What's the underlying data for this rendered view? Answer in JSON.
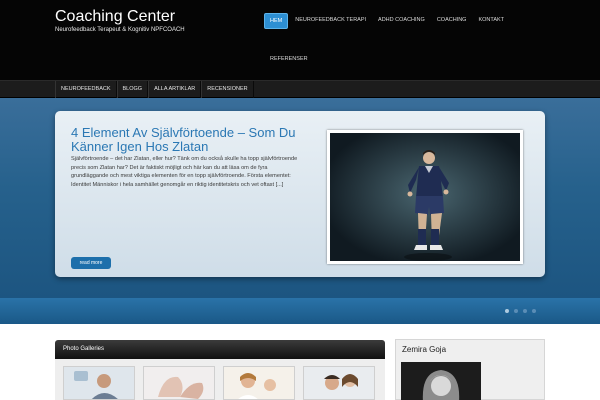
{
  "header": {
    "site_title": "Coaching Center",
    "tagline": "Neurofeedback Terapeut & Kognitiv NPFCOACH"
  },
  "nav": {
    "items": [
      {
        "label": "HEM",
        "active": true
      },
      {
        "label": "NEUROFEEDBACK TERAPI"
      },
      {
        "label": "ADHD COACHING"
      },
      {
        "label": "COACHING"
      },
      {
        "label": "KONTAKT"
      },
      {
        "label": "REFERENSER"
      }
    ]
  },
  "subnav": {
    "items": [
      "NEUROFEEDBACK",
      "BLOGG",
      "ALLA ARTIKLAR",
      "RECENSIONER"
    ]
  },
  "hero": {
    "title": "4 Element Av Självförtoende – Som Du Känner Igen Hos Zlatan",
    "excerpt": "Självförtroende – det har Zlatan, eller hur? Tänk om du också skulle ha topp självförtroende precis som Zlatan har? Det är faktiskt möjligt och här kan du att läsa om de fyra grundläggande och mest viktiga elementen för en topp självförtroende. Första elementet: Identitet Människor i hela samhället genomgår en riktig identitetskris och vet oftast [...]",
    "read_more": "read more",
    "slide_count": 4,
    "active_slide": 1,
    "accent": "#2b78b4"
  },
  "gallery": {
    "title": "Photo Galleries",
    "thumbs": [
      "photo-thumb-1",
      "photo-thumb-2",
      "photo-thumb-3",
      "photo-thumb-4"
    ]
  },
  "sidebar": {
    "title": "Zemira Goja"
  }
}
